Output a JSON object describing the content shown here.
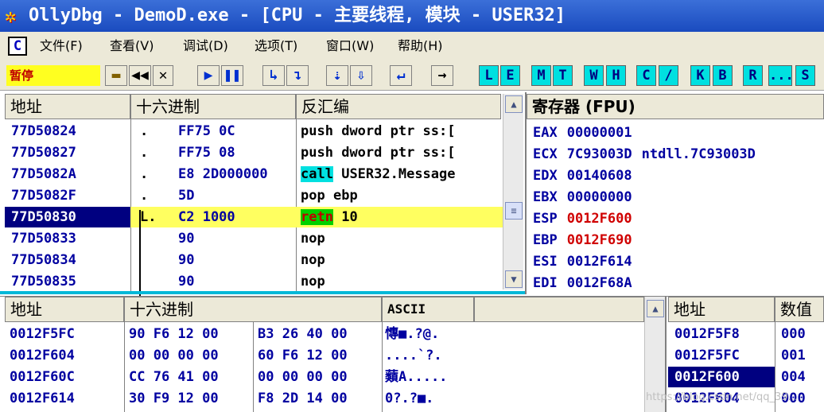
{
  "window": {
    "title": "OllyDbg - DemoD.exe - [CPU - 主要线程, 模块 - USER32]",
    "icon": "bug-icon"
  },
  "menu": {
    "cpu_letter": "C",
    "items": [
      "文件(F)",
      "查看(V)",
      "调试(D)",
      "选项(T)",
      "窗口(W)",
      "帮助(H)"
    ]
  },
  "toolbar": {
    "status": "暂停",
    "buttons": [
      "open-icon",
      "rewind-icon",
      "close-icon",
      "run-icon",
      "pause-icon",
      "step-into-icon",
      "step-over-icon",
      "trace-into-icon",
      "trace-over-icon",
      "execute-till-return-icon",
      "goto-icon"
    ],
    "letters": [
      "L",
      "E",
      "M",
      "T",
      "W",
      "H",
      "C",
      "/",
      "K",
      "B",
      "R",
      "...",
      "S"
    ]
  },
  "disasm": {
    "headers": {
      "address": "地址",
      "hex": "十六进制",
      "disasm": "反汇编"
    },
    "rows": [
      {
        "addr": "77D50824",
        "mark": ".",
        "hex": "FF75 0C",
        "op": "push",
        "operand": "dword ptr ss:["
      },
      {
        "addr": "77D50827",
        "mark": ".",
        "hex": "FF75 08",
        "op": "push",
        "operand": "dword ptr ss:["
      },
      {
        "addr": "77D5082A",
        "mark": ".",
        "hex": "E8 2D000000",
        "op": "call",
        "operand": "USER32.Message"
      },
      {
        "addr": "77D5082F",
        "mark": ".",
        "hex": "5D",
        "op": "pop",
        "operand": "ebp"
      },
      {
        "addr": "77D50830",
        "mark": "L.",
        "hex": "C2 1000",
        "op": "retn",
        "operand": "10"
      },
      {
        "addr": "77D50833",
        "mark": "",
        "hex": "90",
        "op": "nop",
        "operand": ""
      },
      {
        "addr": "77D50834",
        "mark": "",
        "hex": "90",
        "op": "nop",
        "operand": ""
      },
      {
        "addr": "77D50835",
        "mark": "",
        "hex": "90",
        "op": "nop",
        "operand": ""
      }
    ]
  },
  "registers": {
    "header": "寄存器 (FPU)",
    "rows": [
      {
        "name": "EAX",
        "value": "00000001",
        "comment": "",
        "changed": false
      },
      {
        "name": "ECX",
        "value": "7C93003D",
        "comment": "ntdll.7C93003D",
        "changed": false
      },
      {
        "name": "EDX",
        "value": "00140608",
        "comment": "",
        "changed": false
      },
      {
        "name": "EBX",
        "value": "00000000",
        "comment": "",
        "changed": false
      },
      {
        "name": "ESP",
        "value": "0012F600",
        "comment": "",
        "changed": true
      },
      {
        "name": "EBP",
        "value": "0012F690",
        "comment": "",
        "changed": true
      },
      {
        "name": "ESI",
        "value": "0012F614",
        "comment": "",
        "changed": false
      },
      {
        "name": "EDI",
        "value": "0012F68A",
        "comment": "",
        "changed": false
      }
    ]
  },
  "dump": {
    "headers": {
      "address": "地址",
      "hex": "十六进制",
      "ascii": "ASCII"
    },
    "rows": [
      {
        "addr": "0012F5FC",
        "hex1": "90 F6 12 00",
        "hex2": "B3 26 40 00",
        "ascii": "慱■.?@."
      },
      {
        "addr": "0012F604",
        "hex1": "00 00 00 00",
        "hex2": "60 F6 12 00",
        "ascii": "....`?."
      },
      {
        "addr": "0012F60C",
        "hex1": "CC 76 41 00",
        "hex2": "00 00 00 00",
        "ascii": "蘱A....."
      },
      {
        "addr": "0012F614",
        "hex1": "30 F9 12 00",
        "hex2": "F8 2D 14 00",
        "ascii": "0?.?■."
      }
    ]
  },
  "stack": {
    "headers": {
      "address": "地址",
      "value": "数值"
    },
    "rows": [
      {
        "addr": "0012F5F8",
        "value": "000"
      },
      {
        "addr": "0012F5FC",
        "value": "001"
      },
      {
        "addr": "0012F600",
        "value": "004",
        "selected": true
      },
      {
        "addr": "0012F604",
        "value": "000"
      }
    ]
  },
  "watermark": "https://blog.csdn.net/qq_39..."
}
